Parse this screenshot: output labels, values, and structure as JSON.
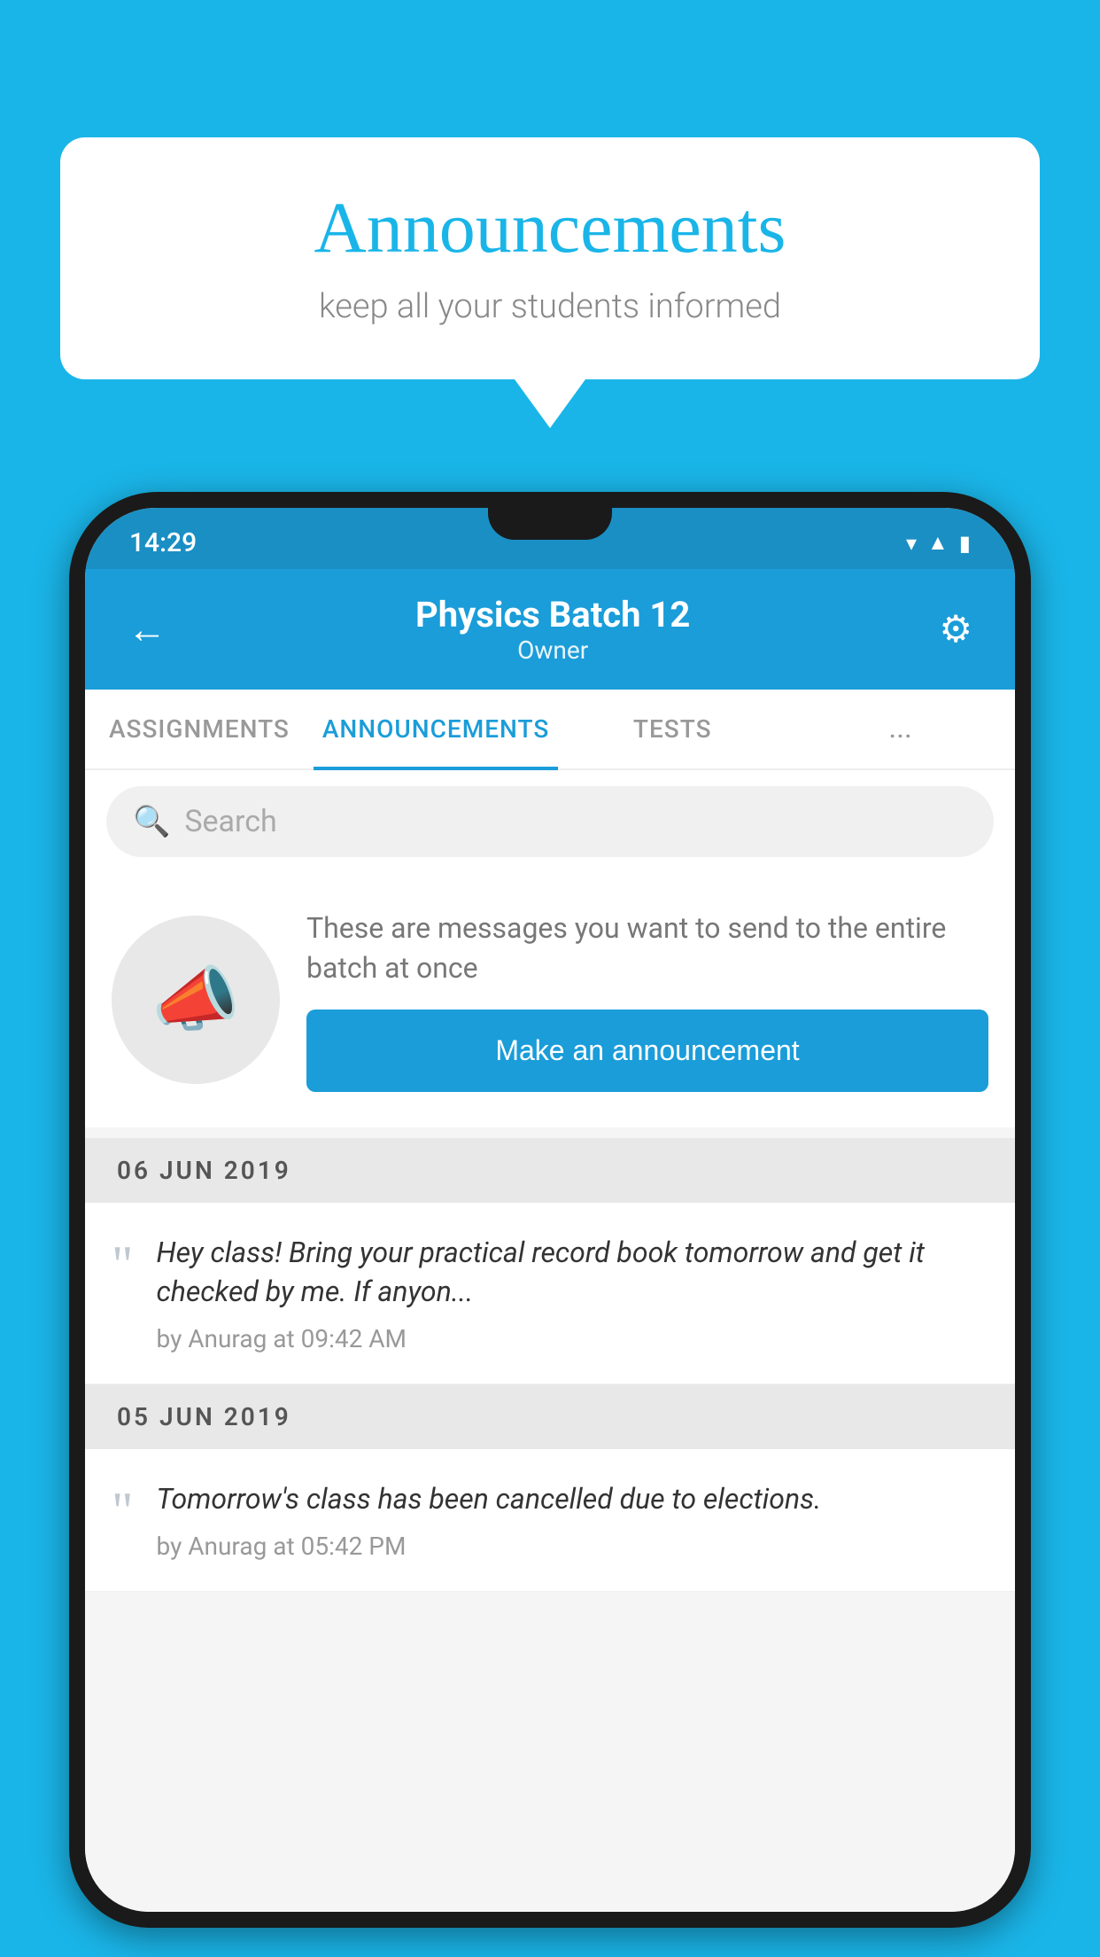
{
  "background_color": "#1ab5e8",
  "speech_bubble": {
    "title": "Announcements",
    "subtitle": "keep all your students informed"
  },
  "phone": {
    "status_bar": {
      "time": "14:29",
      "icons": [
        "wifi",
        "signal",
        "battery"
      ]
    },
    "app_bar": {
      "title": "Physics Batch 12",
      "subtitle": "Owner",
      "back_label": "←",
      "settings_label": "⚙"
    },
    "tabs": [
      {
        "label": "ASSIGNMENTS",
        "active": false
      },
      {
        "label": "ANNOUNCEMENTS",
        "active": true
      },
      {
        "label": "TESTS",
        "active": false
      },
      {
        "label": "...",
        "active": false
      }
    ],
    "search": {
      "placeholder": "Search"
    },
    "promo": {
      "description": "These are messages you want to send to the entire batch at once",
      "button_label": "Make an announcement"
    },
    "announcements": [
      {
        "date": "06  JUN  2019",
        "text": "Hey class! Bring your practical record book tomorrow and get it checked by me. If anyon...",
        "meta": "by Anurag at 09:42 AM"
      },
      {
        "date": "05  JUN  2019",
        "text": "Tomorrow's class has been cancelled due to elections.",
        "meta": "by Anurag at 05:42 PM"
      }
    ]
  }
}
